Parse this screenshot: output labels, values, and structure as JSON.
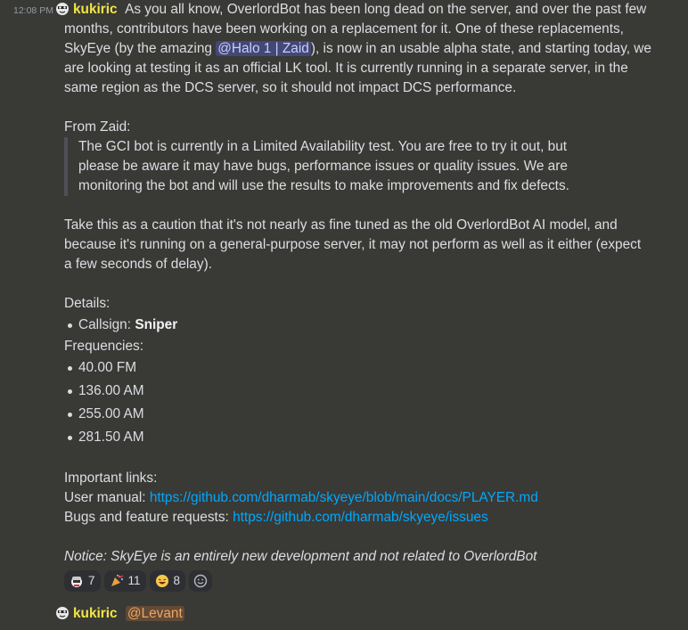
{
  "message": {
    "timestamp": "12:08 PM",
    "author": "kukiric",
    "intro_a": "As you all know, OverlordBot has been long dead on the server, and over the past few",
    "intro_b": "months, contributors have been working on a replacement for it. One of these replacements,",
    "intro_c_before": "SkyEye (by the amazing ",
    "mention_zaid": "@Halo 1 | Zaid",
    "intro_c_after": "), is now in an usable alpha state, and starting today, we",
    "intro_d": "are looking at testing it as an official LK tool. It is currently running in a separate server, in the",
    "intro_e": "same region as the DCS server, so it should not impact DCS performance.",
    "from_label": "From Zaid:",
    "quote_a": "The GCI bot is currently in a Limited Availability test. You are free to try it out, but",
    "quote_b": "please be aware it may have bugs, performance issues or quality issues. We are",
    "quote_c": "monitoring the bot and will use the results to make improvements and fix defects.",
    "caution_a": "Take this as a caution that it's not nearly as fine tuned as the old OverlordBot AI model, and",
    "caution_b": "because it's running on a general-purpose server, it may not perform as well as it either (expect",
    "caution_c": "a few seconds of delay).",
    "details_label": "Details:",
    "callsign_label": "Callsign: ",
    "callsign_value": "Sniper",
    "frequencies_label": "Frequencies:",
    "frequencies": [
      "40.00 FM",
      "136.00 AM",
      "255.00 AM",
      "281.50 AM"
    ],
    "links_label": "Important links:",
    "manual_label": "User manual: ",
    "manual_url": "https://github.com/dharmab/skyeye/blob/main/docs/PLAYER.md",
    "bugs_label": "Bugs and feature requests: ",
    "bugs_url": "https://github.com/dharmab/skyeye/issues",
    "notice": "Notice: SkyEye is an entirely new development and not related to OverlordBot",
    "reactions": [
      {
        "icon": "pilot-emoji",
        "count": "7"
      },
      {
        "icon": "party-popper-emoji",
        "count": "11"
      },
      {
        "icon": "laughing-emoji",
        "count": "8"
      }
    ]
  },
  "reply": {
    "author": "kukiric",
    "mention": "@Levant"
  },
  "colors": {
    "background": "#393936",
    "username": "#f0e646",
    "link": "#00a8fc",
    "mention_bg": "#5865f2"
  }
}
